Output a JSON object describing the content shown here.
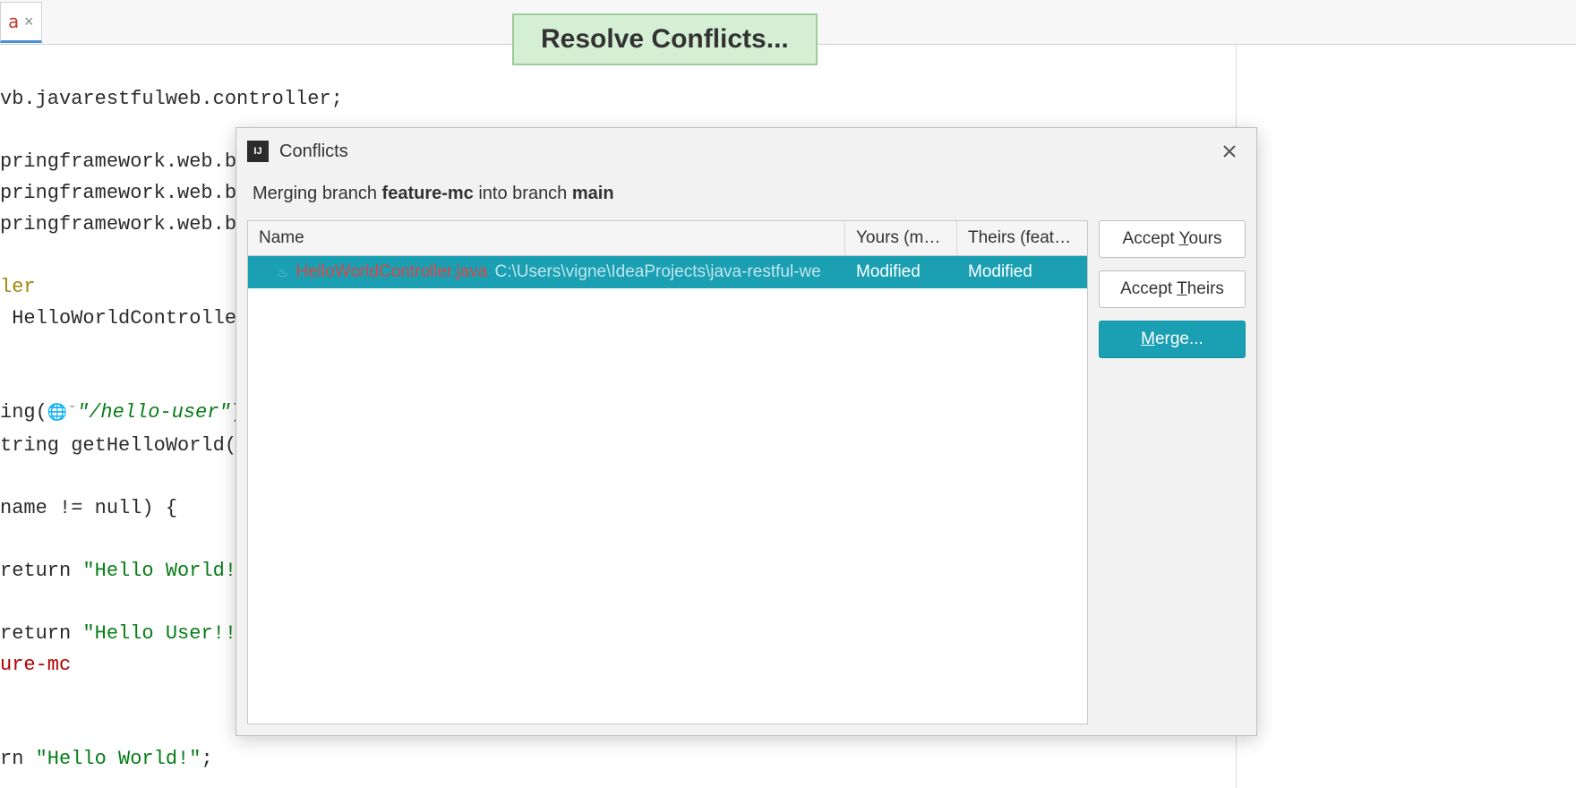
{
  "banner": {
    "text": "Resolve Conflicts..."
  },
  "tab": {
    "name": "a",
    "close": "×"
  },
  "editor": {
    "lines": [
      "vb.javarestfulweb.controller;",
      "",
      "pringframework.web.bind.annotation.",
      "pringframework.web.b",
      "pringframework.web.b",
      "",
      "ler",
      " HelloWorldControlle",
      "",
      "",
      "ing(",
      "tring getHelloWorld(",
      "",
      "name != null) {",
      "",
      "return ",
      "",
      "return ",
      "ure-mc",
      "",
      "",
      "rn "
    ],
    "annotation": "GetMapping",
    "url_path": "\"/hello-user\"",
    "str_hello_world": "\"Hello World!",
    "str_hello_user": "\"Hello User!!",
    "str_hello_world2": "\"Hello World!\"",
    "semicolon": ";",
    "paren": ")"
  },
  "dialog": {
    "title": "Conflicts",
    "subtitle_prefix": "Merging branch ",
    "branch_from": "feature-mc",
    "subtitle_mid": " into branch ",
    "branch_to": "main",
    "columns": {
      "name": "Name",
      "yours": "Yours (main)",
      "theirs": "Theirs (feature..."
    },
    "row": {
      "filename": "HelloWorldController.java",
      "path": "C:\\Users\\vigne\\IdeaProjects\\java-restful-we",
      "yours": "Modified",
      "theirs": "Modified"
    },
    "buttons": {
      "accept_yours_pre": "Accept ",
      "accept_yours_mn": "Y",
      "accept_yours_post": "ours",
      "accept_theirs_pre": "Accept ",
      "accept_theirs_mn": "T",
      "accept_theirs_post": "heirs",
      "merge_mn": "M",
      "merge_post": "erge..."
    }
  }
}
